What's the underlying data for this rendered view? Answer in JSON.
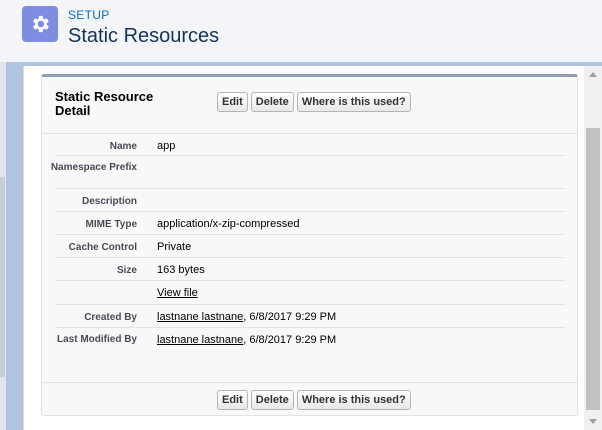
{
  "header": {
    "section_label": "SETUP",
    "title": "Static Resources",
    "icon": "gear-icon"
  },
  "card": {
    "title": "Static Resource Detail",
    "buttons": {
      "edit": "Edit",
      "delete": "Delete",
      "where_used": "Where is this used?"
    }
  },
  "fields": {
    "name": {
      "label": "Name",
      "value": "app"
    },
    "namespace_prefix": {
      "label": "Namespace Prefix",
      "value": ""
    },
    "description": {
      "label": "Description",
      "value": ""
    },
    "mime_type": {
      "label": "MIME Type",
      "value": "application/x-zip-compressed"
    },
    "cache_control": {
      "label": "Cache Control",
      "value": "Private"
    },
    "size": {
      "label": "Size",
      "value": "163 bytes"
    },
    "view_file": {
      "label": "",
      "value": "View file"
    },
    "created_by": {
      "label": "Created By",
      "user": "lastnane lastnane",
      "date": ", 6/8/2017 9:29 PM"
    },
    "last_modified_by": {
      "label": "Last Modified By",
      "user": "lastnane lastnane",
      "date": ", 6/8/2017 9:29 PM"
    }
  },
  "colors": {
    "accent": "#0070d2",
    "icon_bg": "#7f8de1",
    "background": "#b0c4df"
  }
}
